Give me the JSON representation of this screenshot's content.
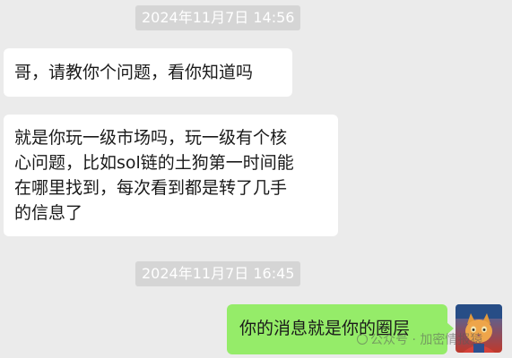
{
  "chat": {
    "timestamps": [
      "2024年11月7日 14:56",
      "2024年11月7日 16:45"
    ],
    "messages": [
      {
        "sender": "other",
        "lines": [
          "哥，请教你个问题，看你知道吗"
        ]
      },
      {
        "sender": "other",
        "lines": [
          "就是你玩一级市场吗，玩一级有个核",
          "心问题，比如sol链的土狗第一时间能",
          "在哪里找到，每次看到都是转了几手",
          "的信息了"
        ]
      },
      {
        "sender": "self",
        "lines": [
          "你的消息就是你的圈层"
        ]
      }
    ],
    "self_avatar_icon": "avatar-cat-icon"
  },
  "watermark": {
    "text": "公众号 · 加密情报猿"
  },
  "colors": {
    "background": "#ebebeb",
    "incoming_bubble": "#ffffff",
    "outgoing_bubble": "#95ec69",
    "timestamp_bg": "#d5d5d5",
    "timestamp_text": "#ffffff"
  }
}
